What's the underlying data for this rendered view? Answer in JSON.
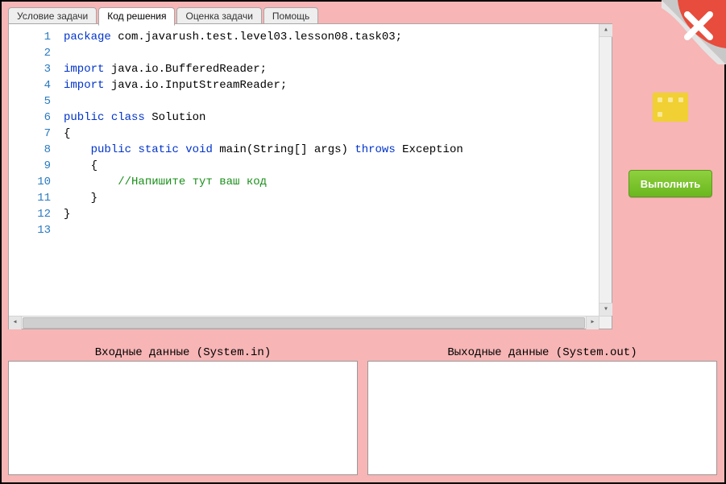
{
  "tabs": [
    {
      "label": "Условие задачи",
      "active": false
    },
    {
      "label": "Код решения",
      "active": true
    },
    {
      "label": "Оценка задачи",
      "active": false
    },
    {
      "label": "Помощь",
      "active": false
    }
  ],
  "run_button_label": "Выполнить",
  "io": {
    "input_label": "Входные данные (System.in)",
    "output_label": "Выходные данные (System.out)"
  },
  "close_icon_name": "close-x",
  "decor_icon_name": "dice-icon",
  "code": {
    "line_count": 13,
    "tokens_by_line": [
      [
        {
          "t": "package",
          "c": "kw"
        },
        {
          "t": " com.javarush.test.level03.lesson08.task03;",
          "c": "txt"
        }
      ],
      [],
      [
        {
          "t": "import",
          "c": "kw"
        },
        {
          "t": " java.io.BufferedReader;",
          "c": "txt"
        }
      ],
      [
        {
          "t": "import",
          "c": "kw"
        },
        {
          "t": " java.io.InputStreamReader;",
          "c": "txt"
        }
      ],
      [],
      [
        {
          "t": "public",
          "c": "kw"
        },
        {
          "t": " ",
          "c": "txt"
        },
        {
          "t": "class",
          "c": "kw"
        },
        {
          "t": " Solution",
          "c": "txt"
        }
      ],
      [
        {
          "t": "{",
          "c": "txt"
        }
      ],
      [
        {
          "t": "    ",
          "c": "txt"
        },
        {
          "t": "public",
          "c": "kw"
        },
        {
          "t": " ",
          "c": "txt"
        },
        {
          "t": "static",
          "c": "kw"
        },
        {
          "t": " ",
          "c": "txt"
        },
        {
          "t": "void",
          "c": "kw"
        },
        {
          "t": " main(String[] args) ",
          "c": "txt"
        },
        {
          "t": "throws",
          "c": "kw"
        },
        {
          "t": " Exception",
          "c": "txt"
        }
      ],
      [
        {
          "t": "    {",
          "c": "txt"
        }
      ],
      [
        {
          "t": "        ",
          "c": "txt"
        },
        {
          "t": "//Напишите тут ваш код",
          "c": "cmt"
        }
      ],
      [
        {
          "t": "    }",
          "c": "txt"
        }
      ],
      [
        {
          "t": "}",
          "c": "txt"
        }
      ],
      []
    ]
  }
}
